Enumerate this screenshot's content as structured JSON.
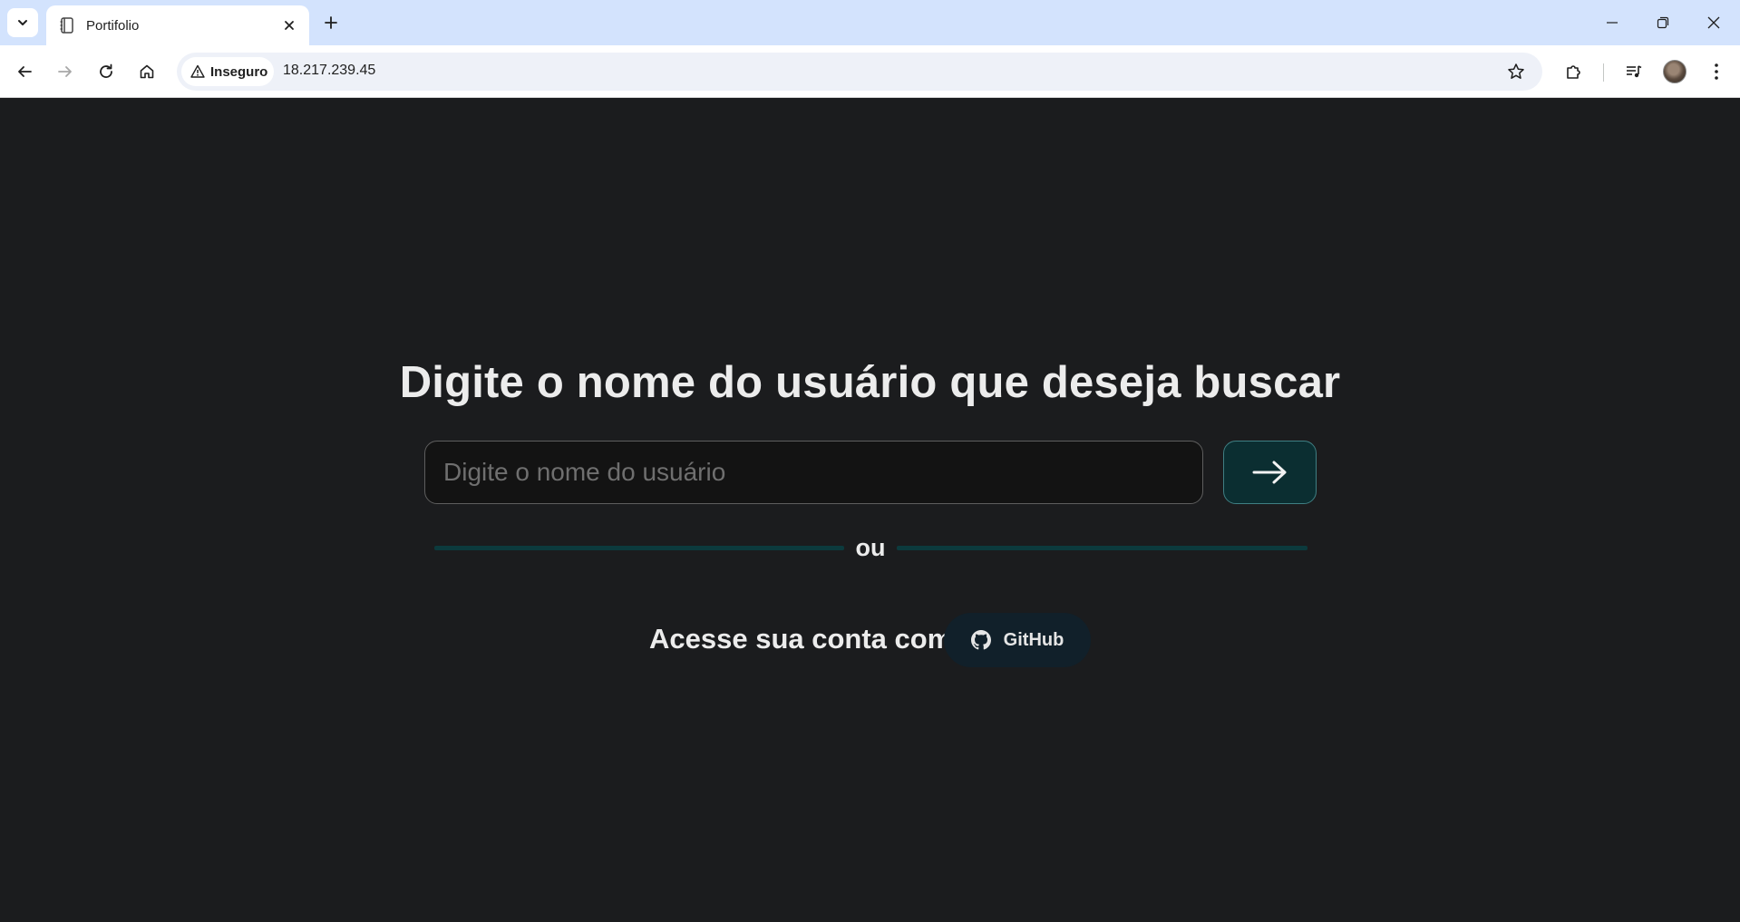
{
  "browser": {
    "tab": {
      "title": "Portifolio"
    },
    "address_bar": {
      "security_label": "Inseguro",
      "url": "18.217.239.45"
    }
  },
  "page": {
    "heading": "Digite o nome do usuário que deseja buscar",
    "search": {
      "placeholder": "Digite o nome do usuário",
      "value": ""
    },
    "divider_text": "ou",
    "login": {
      "label": "Acesse sua conta com",
      "github_button": "GitHub"
    }
  },
  "colors": {
    "page_background": "#1b1c1e",
    "accent": "#0b2e31",
    "accent_border": "#3f7f83",
    "github_button_bg": "#11202a"
  },
  "icons": {
    "tab_search": "chevron-down-icon",
    "favicon": "notebook-icon",
    "tab_close": "close-icon",
    "new_tab": "plus-icon",
    "back": "arrow-left-icon",
    "forward": "arrow-right-icon",
    "reload": "reload-icon",
    "home": "home-icon",
    "security": "warning-icon",
    "bookmark": "star-icon",
    "extensions": "puzzle-icon",
    "media": "media-queue-icon",
    "menu": "kebab-menu-icon",
    "submit": "arrow-right-icon",
    "github": "github-icon"
  }
}
